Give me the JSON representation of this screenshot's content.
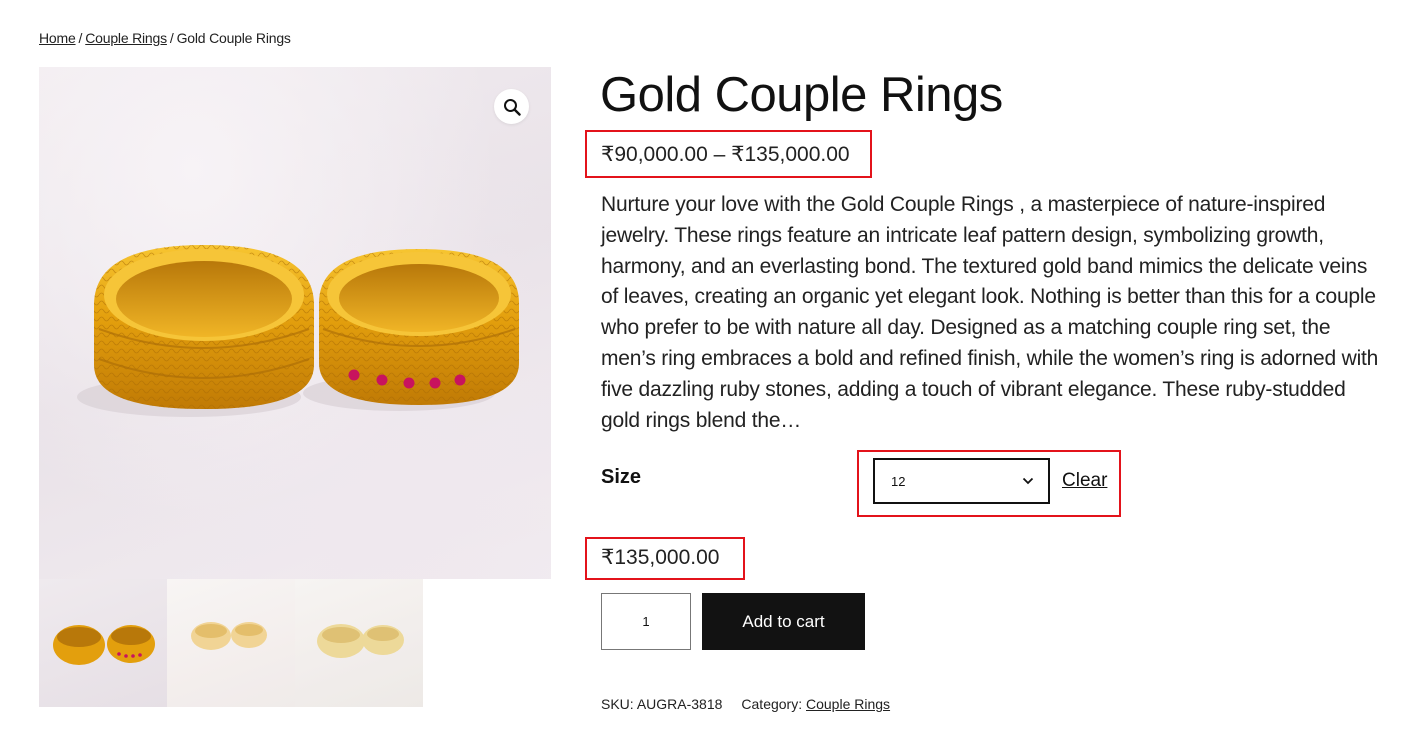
{
  "breadcrumb": {
    "home": "Home",
    "separator": "/",
    "category": "Couple Rings",
    "current": "Gold Couple Rings"
  },
  "gallery": {
    "zoom_icon": "magnifier-icon",
    "thumbnail_count": 3
  },
  "product": {
    "title": "Gold Couple Rings",
    "price_range": "₹90,000.00 – ₹135,000.00",
    "description": "Nurture your love with the Gold Couple Rings , a masterpiece of nature-inspired jewelry. These rings feature an intricate leaf pattern design, symbolizing growth, harmony, and an everlasting bond. The textured gold band mimics the delicate veins of leaves, creating an organic yet elegant look. Nothing is better than this for a couple who prefer to be with nature all day. Designed as a matching couple ring set, the men’s ring embraces a bold and refined finish, while the women’s ring is adorned with five dazzling ruby stones, adding a touch of vibrant elegance. These ruby-studded gold rings blend the…",
    "size_label": "Size",
    "size_selected": "12",
    "clear_label": "Clear",
    "variation_price": "₹135,000.00",
    "quantity": "1",
    "add_to_cart_label": "Add to cart",
    "sku_label": "SKU:",
    "sku_value": "AUGRA-3818",
    "category_label": "Category:",
    "category_value": "Couple Rings"
  },
  "colors": {
    "highlight": "#e3131b",
    "button_bg": "#121212",
    "gold": "#e8a90f",
    "ruby": "#c8135e"
  }
}
